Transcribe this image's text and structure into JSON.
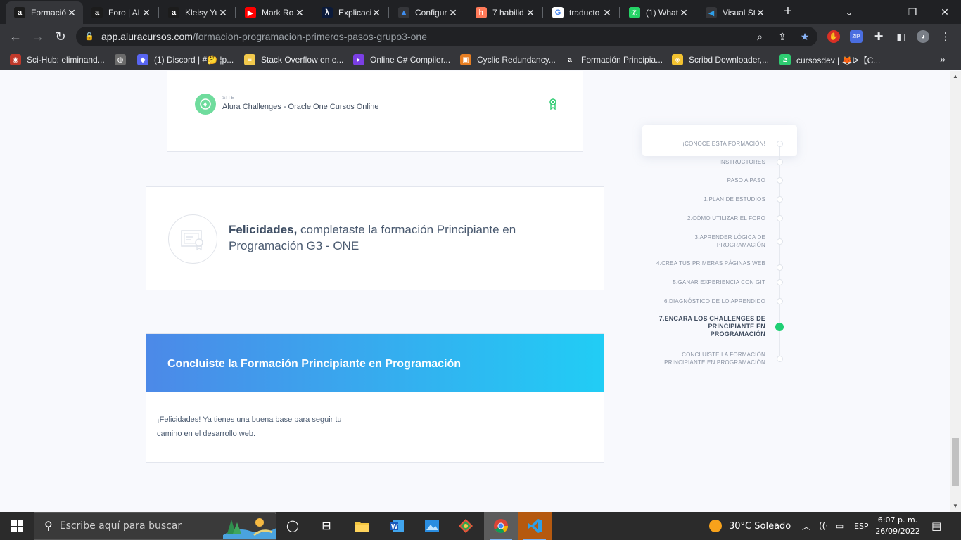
{
  "browser": {
    "tabs": [
      {
        "title": "Formació",
        "favicon": "a",
        "favicon_color": "#1c1c1c",
        "favicon_fg": "#fff"
      },
      {
        "title": "Foro | Al",
        "favicon": "a",
        "favicon_color": "#1c1c1c",
        "favicon_fg": "#fff"
      },
      {
        "title": "Kleisy Yu",
        "favicon": "a",
        "favicon_color": "#1c1c1c",
        "favicon_fg": "#fff"
      },
      {
        "title": "Mark Ro",
        "favicon": "▶",
        "favicon_color": "#ff0000",
        "favicon_fg": "#fff"
      },
      {
        "title": "Explicaci",
        "favicon": "λ",
        "favicon_color": "#0b1a3a",
        "favicon_fg": "#fff"
      },
      {
        "title": "Configur",
        "favicon": "▲",
        "favicon_color": "#35363a",
        "favicon_fg": "#3f8ef0"
      },
      {
        "title": "7 habilid",
        "favicon": "h",
        "favicon_color": "#ff7a59",
        "favicon_fg": "#fff"
      },
      {
        "title": "traducto",
        "favicon": "G",
        "favicon_color": "#ffffff",
        "favicon_fg": "#4285f4"
      },
      {
        "title": "(1) What",
        "favicon": "✆",
        "favicon_color": "#25d366",
        "favicon_fg": "#fff"
      },
      {
        "title": "Visual St",
        "favicon": "◀",
        "favicon_color": "#35363a",
        "favicon_fg": "#2e9fe8"
      }
    ],
    "new_tab_label": "+",
    "url_domain": "app.aluracursos.com",
    "url_path": "/formacion-programacion-primeros-pasos-grupo3-one",
    "bookmarks": [
      {
        "label": "Sci-Hub: eliminand...",
        "icon": "◉",
        "color": "#c0392b"
      },
      {
        "label": "",
        "icon": "◍",
        "color": "#6b6b6b"
      },
      {
        "label": "(1) Discord | #🤔 ¦p...",
        "icon": "◆",
        "color": "#5865f2"
      },
      {
        "label": "Stack Overflow en e...",
        "icon": "≡",
        "color": "#f2c94c"
      },
      {
        "label": "Online C# Compiler...",
        "icon": "▸",
        "color": "#7b3fe4"
      },
      {
        "label": "Cyclic Redundancy...",
        "icon": "▣",
        "color": "#e67e22"
      },
      {
        "label": "Formación Principia...",
        "icon": "a",
        "color": "#35363a"
      },
      {
        "label": "Scribd Downloader,...",
        "icon": "◈",
        "color": "#f2c230"
      },
      {
        "label": "cursosdev | 🦊ᐅ【C...",
        "icon": "≥",
        "color": "#2ecc71"
      }
    ]
  },
  "page": {
    "site_card": {
      "kicker": "SITE",
      "title": "Alura Challenges - Oracle One Cursos Online"
    },
    "congrats": {
      "bold": "Felicidades,",
      "text": " completaste la formación Principiante en Programación G3 - ONE"
    },
    "concluded": {
      "title": "Concluiste la Formación Principiante en Programación",
      "body": "¡Felicidades! Ya tienes una buena base para seguir tu camino en el desarrollo web."
    },
    "steps": [
      {
        "label": "¡CONOCE ESTA FORMACIÓN!",
        "current": false
      },
      {
        "label": "INSTRUCTORES",
        "current": false
      },
      {
        "label": "PASO A PASO",
        "current": false
      },
      {
        "label": "1.PLAN DE ESTUDIOS",
        "current": false
      },
      {
        "label": "2.CÓMO UTILIZAR EL FORO",
        "current": false
      },
      {
        "label": "3.APRENDER LÓGICA DE PROGRAMACIÓN",
        "current": false
      },
      {
        "label": "4.CREA TUS PRIMERAS PÁGINAS WEB",
        "current": false
      },
      {
        "label": "5.GANAR EXPERIENCIA CON GIT",
        "current": false
      },
      {
        "label": "6.DIAGNÓSTICO DE LO APRENDIDO",
        "current": false
      },
      {
        "label": "7.ENCARA LOS CHALLENGES DE PRINCIPIANTE EN PROGRAMACIÓN",
        "current": true
      },
      {
        "label": "CONCLUISTE LA FORMACIÓN PRINCIPIANTE EN PROGRAMACIÓN",
        "current": false
      }
    ]
  },
  "taskbar": {
    "search_placeholder": "Escribe aquí para buscar",
    "weather": "30°C  Soleado",
    "language": "ESP",
    "time": "6:07 p. m.",
    "date": "26/09/2022"
  }
}
